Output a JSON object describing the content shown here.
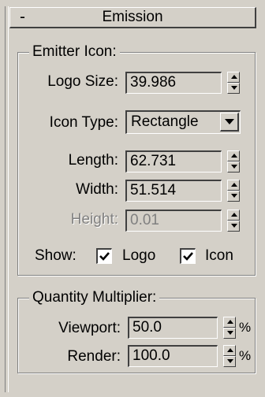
{
  "rollout": {
    "title": "Emission",
    "toggle_symbol": "-"
  },
  "emitter_icon": {
    "group_title": "Emitter Icon:",
    "logo_size": {
      "label": "Logo Size:",
      "value": "39.986"
    },
    "icon_type": {
      "label": "Icon Type:",
      "value": "Rectangle"
    },
    "length": {
      "label": "Length:",
      "value": "62.731"
    },
    "width": {
      "label": "Width:",
      "value": "51.514"
    },
    "height": {
      "label": "Height:",
      "value": "0.01",
      "disabled": true
    },
    "show": {
      "label": "Show:",
      "logo": {
        "label": "Logo",
        "checked": true
      },
      "icon": {
        "label": "Icon",
        "checked": true
      }
    }
  },
  "quantity_multiplier": {
    "group_title": "Quantity Multiplier:",
    "viewport": {
      "label": "Viewport:",
      "value": "50.0",
      "unit": "%"
    },
    "render": {
      "label": "Render:",
      "value": "100.0",
      "unit": "%"
    }
  },
  "icons": [
    "spinner-arrows-icon",
    "dropdown-arrow-icon",
    "checkmark-icon"
  ]
}
